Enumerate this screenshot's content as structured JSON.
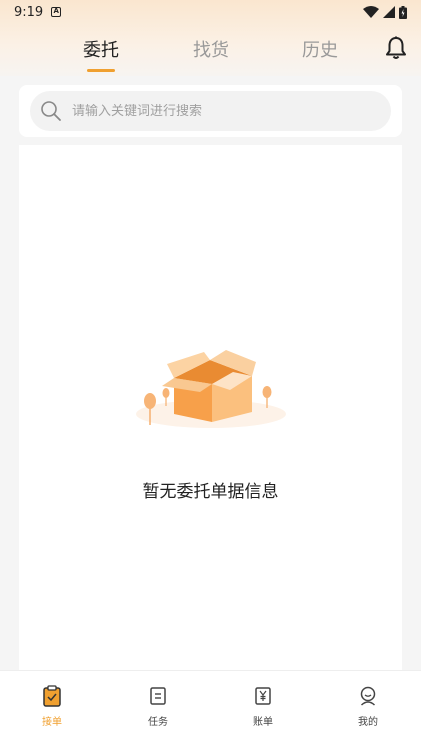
{
  "status_bar": {
    "time": "9:19",
    "notification_icon": "A"
  },
  "tabs": [
    {
      "label": "委托",
      "active": true
    },
    {
      "label": "找货",
      "active": false
    },
    {
      "label": "历史",
      "active": false
    }
  ],
  "search": {
    "placeholder": "请输入关键词进行搜索",
    "value": ""
  },
  "empty_state": {
    "message": "暂无委托单据信息"
  },
  "bottom_nav": [
    {
      "label": "接单",
      "icon": "clipboard-check-icon",
      "active": true
    },
    {
      "label": "任务",
      "icon": "task-list-icon",
      "active": false
    },
    {
      "label": "账单",
      "icon": "bill-yen-icon",
      "active": false
    },
    {
      "label": "我的",
      "icon": "profile-icon",
      "active": false
    }
  ],
  "colors": {
    "accent": "#f0a030",
    "header_gradient_top": "#fae6cf",
    "background": "#f5f5f5"
  }
}
